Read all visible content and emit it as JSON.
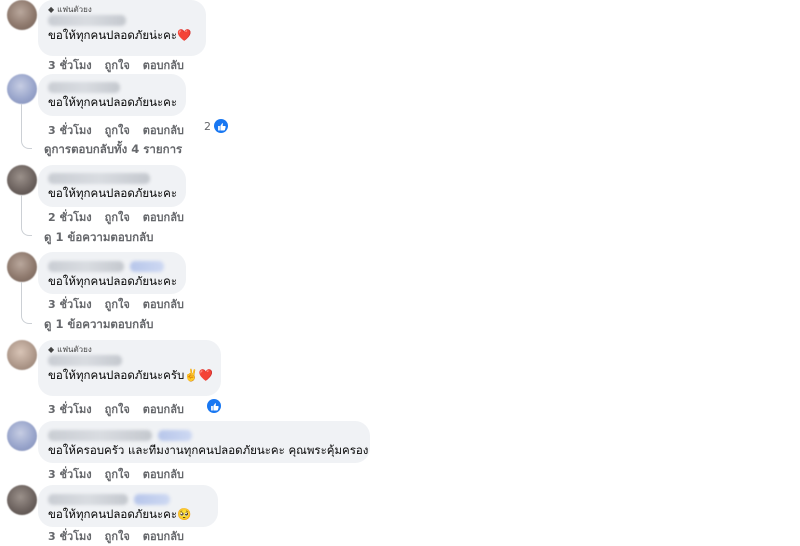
{
  "actions": {
    "time_3h": "3 ชั่วโมง",
    "time_2h": "2 ชั่วโมง",
    "like": "ถูกใจ",
    "reply": "ตอบกลับ"
  },
  "comments": [
    {
      "badge": "แฟนตัวยง",
      "text": "ขอให้ทุกคนปลอดภัยน่ะคะ",
      "emoji": "❤️"
    },
    {
      "text": "ขอให้ทุกคนปลอดภัยนะคะ",
      "reaction_count": "2",
      "view_replies": "ดูการตอบกลับทั้ง 4 รายการ"
    },
    {
      "text": "ขอให้ทุกคนปลอดภัยนะคะ",
      "view_replies": "ดู 1 ข้อความตอบกลับ"
    },
    {
      "text": "ขอให้ทุกคนปลอดภัยนะคะ",
      "view_replies": "ดู 1 ข้อความตอบกลับ"
    },
    {
      "badge": "แฟนตัวยง",
      "text": "ขอให้ทุกคนปลอดภัยนะครับ",
      "emoji": "✌️❤️"
    },
    {
      "text": "ขอให้ครอบครัว และทีมงานทุกคนปลอดภัยนะคะ คุณพระคุ้มครอง"
    },
    {
      "text": "ขอให้ทุกคนปลอดภัยนะคะ",
      "emoji": "🥺"
    }
  ]
}
